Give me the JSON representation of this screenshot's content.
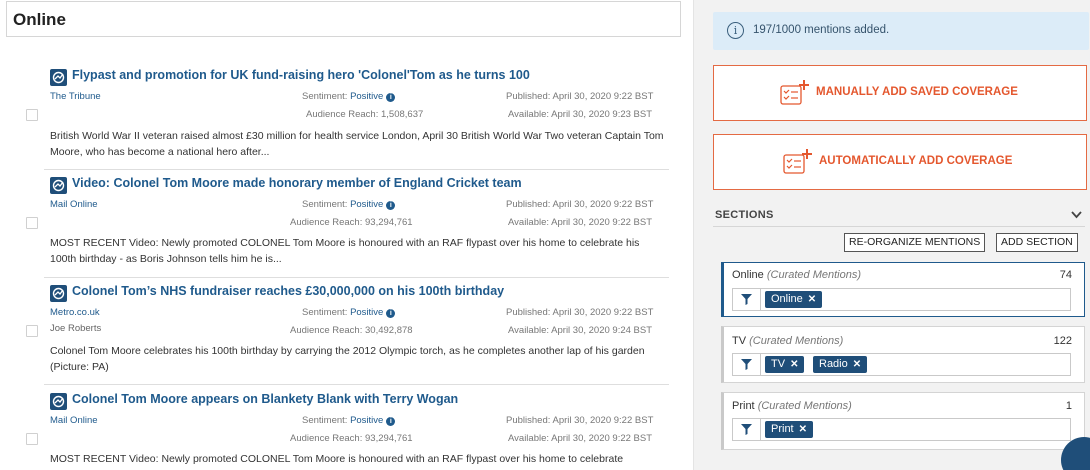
{
  "page_title": "Online",
  "articles": [
    {
      "title": "Flypast and promotion for UK fund-raising hero 'Colonel'Tom as he turns 100",
      "source": "The Tribune",
      "author": "",
      "sentiment_label": "Sentiment:",
      "sentiment": "Positive",
      "reach_label": "Audience Reach:",
      "reach": "1,508,637",
      "published_label": "Published:",
      "published": "April 30, 2020 9:22 BST",
      "available_label": "Available:",
      "available": "April 30, 2020 9:23 BST",
      "snippet": "British World War II veteran raised almost £30 million for health service London, April 30 British World War Two veteran Captain Tom Moore, who has become a national hero after..."
    },
    {
      "title": "Video: Colonel Tom Moore made honorary member of England Cricket team",
      "source": "Mail Online",
      "author": "",
      "sentiment_label": "Sentiment:",
      "sentiment": "Positive",
      "reach_label": "Audience Reach:",
      "reach": "93,294,761",
      "published_label": "Published:",
      "published": "April 30, 2020 9:22 BST",
      "available_label": "Available:",
      "available": "April 30, 2020 9:22 BST",
      "snippet": "MOST RECENT Video: Newly promoted COLONEL Tom Moore is honoured with an RAF flypast over his home to celebrate his 100th birthday - as Boris Johnson tells him he is..."
    },
    {
      "title": "Colonel Tom’s NHS fundraiser reaches £30,000,000 on his 100th birthday",
      "source": "Metro.co.uk",
      "author": "Joe Roberts",
      "sentiment_label": "Sentiment:",
      "sentiment": "Positive",
      "reach_label": "Audience Reach:",
      "reach": "30,492,878",
      "published_label": "Published:",
      "published": "April 30, 2020 9:22 BST",
      "available_label": "Available:",
      "available": "April 30, 2020 9:24 BST",
      "snippet": "Colonel Tom Moore celebrates his 100th birthday by carrying the 2012 Olympic torch, as he completes another lap of his garden (Picture: PA)"
    },
    {
      "title": "Colonel Tom Moore appears on Blankety Blank with Terry Wogan",
      "source": "Mail Online",
      "author": "",
      "sentiment_label": "Sentiment:",
      "sentiment": "Positive",
      "reach_label": "Audience Reach:",
      "reach": "93,294,761",
      "published_label": "Published:",
      "published": "April 30, 2020 9:22 BST",
      "available_label": "Available:",
      "available": "April 30, 2020 9:22 BST",
      "snippet": "MOST RECENT Video: Newly promoted COLONEL Tom Moore is honoured with an RAF flypast over his home to celebrate"
    }
  ],
  "sidebar": {
    "notice": "197/1000 mentions added.",
    "manual_add": "MANUALLY ADD SAVED COVERAGE",
    "auto_add": "AUTOMATICALLY ADD COVERAGE",
    "sections_header": "SECTIONS",
    "reorganize_button": "RE-ORGANIZE MENTIONS",
    "add_section_button": "ADD SECTION",
    "sections": [
      {
        "name": "Online",
        "sub": "(Curated Mentions)",
        "count": "74",
        "chips": [
          "Online"
        ]
      },
      {
        "name": "TV",
        "sub": "(Curated Mentions)",
        "count": "122",
        "chips": [
          "TV",
          "Radio"
        ]
      },
      {
        "name": "Print",
        "sub": "(Curated Mentions)",
        "count": "1",
        "chips": [
          "Print"
        ]
      }
    ]
  },
  "colors": {
    "accent": "#1f4e79",
    "link": "#1f5a8c",
    "action": "#e4572e",
    "notice_bg": "#dcecf8"
  },
  "icons": [
    "outlet-icon",
    "info-icon",
    "checklist-add-icon",
    "filter-icon",
    "chevron-down-icon",
    "close-icon",
    "chat-icon"
  ]
}
